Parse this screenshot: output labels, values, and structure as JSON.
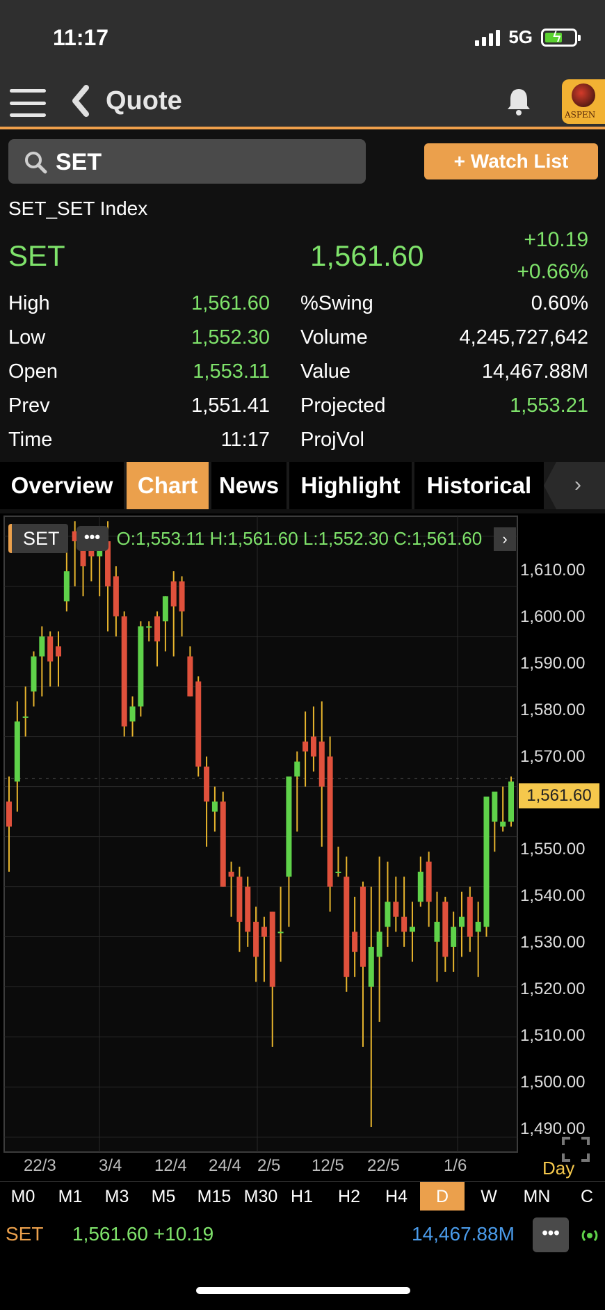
{
  "status_bar": {
    "time": "11:17",
    "network": "5G"
  },
  "header": {
    "title": "Quote"
  },
  "logo": {
    "text": "ASPEN"
  },
  "search": {
    "value": "SET"
  },
  "watch_list_label": "+ Watch List",
  "quote": {
    "index_name": "SET_SET Index",
    "symbol": "SET",
    "last": "1,561.60",
    "change": "+10.19",
    "change_pct": "+0.66%"
  },
  "stats": {
    "left": [
      {
        "label": "High",
        "value": "1,561.60",
        "color": "green"
      },
      {
        "label": "Low",
        "value": "1,552.30",
        "color": "green"
      },
      {
        "label": "Open",
        "value": "1,553.11",
        "color": "green"
      },
      {
        "label": "Prev",
        "value": "1,551.41",
        "color": "white"
      },
      {
        "label": "Time",
        "value": "11:17",
        "color": "white"
      }
    ],
    "right": [
      {
        "label": "%Swing",
        "value": "0.60%",
        "color": "white"
      },
      {
        "label": "Volume",
        "value": "4,245,727,642",
        "color": "white"
      },
      {
        "label": "Value",
        "value": "14,467.88M",
        "color": "white"
      },
      {
        "label": "Projected",
        "value": "1,553.21",
        "color": "green"
      },
      {
        "label": "ProjVol",
        "value": "",
        "color": "white"
      }
    ]
  },
  "tabs": [
    "Overview",
    "Chart",
    "News",
    "Highlight",
    "Historical"
  ],
  "active_tab": "Chart",
  "chart_header": {
    "symbol": "SET",
    "more": "•••",
    "ohlc": "O:1,553.11  H:1,561.60  L:1,552.30  C:1,561.60"
  },
  "chart_data": {
    "type": "candlestick",
    "y_ticks": [
      "1,610.00",
      "1,600.00",
      "1,590.00",
      "1,580.00",
      "1,570.00",
      "1,560.00",
      "1,550.00",
      "1,540.00",
      "1,530.00",
      "1,520.00",
      "1,510.00",
      "1,500.00",
      "1,490.00"
    ],
    "ylim": [
      1487,
      1614
    ],
    "x_ticks": [
      "22/3",
      "3/4",
      "12/4",
      "24/4",
      "2/5",
      "12/5",
      "22/5",
      "1/6"
    ],
    "last_price_flag": "1,561.60",
    "period_label": "Day",
    "colors": {
      "up": "#5fd24a",
      "down": "#e0513c",
      "wick": "#e8b52d"
    },
    "candles": [
      [
        1557,
        1562,
        1543,
        1552
      ],
      [
        1561,
        1577,
        1555,
        1573
      ],
      [
        1574,
        1580,
        1570,
        1574
      ],
      [
        1579,
        1587,
        1576,
        1586
      ],
      [
        1586,
        1592,
        1578,
        1590
      ],
      [
        1590,
        1591,
        1580,
        1585
      ],
      [
        1588,
        1591,
        1580,
        1586
      ],
      [
        1597,
        1607,
        1595,
        1603
      ],
      [
        1611,
        1613,
        1600,
        1609
      ],
      [
        1609,
        1612,
        1598,
        1604
      ],
      [
        1609,
        1612,
        1601,
        1606
      ],
      [
        1606,
        1609,
        1598,
        1609
      ],
      [
        1609,
        1613,
        1591,
        1600
      ],
      [
        1602,
        1604,
        1590,
        1594
      ],
      [
        1594,
        1595,
        1570,
        1572
      ],
      [
        1573,
        1578,
        1570,
        1576
      ],
      [
        1576,
        1593,
        1574,
        1592
      ],
      [
        1592,
        1593,
        1589,
        1592
      ],
      [
        1594,
        1595,
        1584,
        1589
      ],
      [
        1593,
        1598,
        1587,
        1598
      ],
      [
        1601,
        1603,
        1586,
        1596
      ],
      [
        1601,
        1602,
        1590,
        1595
      ],
      [
        1586,
        1588,
        1578,
        1578
      ],
      [
        1581,
        1582,
        1562,
        1564
      ],
      [
        1564,
        1566,
        1548,
        1557
      ],
      [
        1555,
        1560,
        1551,
        1557
      ],
      [
        1557,
        1559,
        1540,
        1540
      ],
      [
        1543,
        1545,
        1534,
        1542
      ],
      [
        1542,
        1544,
        1527,
        1533
      ],
      [
        1540,
        1542,
        1528,
        1531
      ],
      [
        1533,
        1536,
        1521,
        1526
      ],
      [
        1532,
        1534,
        1521,
        1530
      ],
      [
        1535,
        1535,
        1508,
        1520
      ],
      [
        1531,
        1540,
        1525,
        1531
      ],
      [
        1542,
        1550,
        1532,
        1562
      ],
      [
        1562,
        1567,
        1551,
        1565
      ],
      [
        1569,
        1575,
        1560,
        1567
      ],
      [
        1570,
        1576,
        1563,
        1566
      ],
      [
        1569,
        1577,
        1548,
        1560
      ],
      [
        1566,
        1570,
        1535,
        1540
      ],
      [
        1543,
        1548,
        1542,
        1543
      ],
      [
        1542,
        1546,
        1519,
        1522
      ],
      [
        1531,
        1538,
        1522,
        1527
      ],
      [
        1540,
        1541,
        1508,
        1524
      ],
      [
        1520,
        1540,
        1492,
        1528
      ],
      [
        1526,
        1546,
        1513,
        1531
      ],
      [
        1532,
        1545,
        1528,
        1537
      ],
      [
        1537,
        1542,
        1531,
        1534
      ],
      [
        1534,
        1542,
        1528,
        1531
      ],
      [
        1531,
        1537,
        1525,
        1532
      ],
      [
        1537,
        1546,
        1536,
        1543
      ],
      [
        1545,
        1547,
        1532,
        1537
      ],
      [
        1529,
        1539,
        1521,
        1533
      ],
      [
        1537,
        1538,
        1523,
        1526
      ],
      [
        1528,
        1535,
        1523,
        1532
      ],
      [
        1532,
        1539,
        1526,
        1534
      ],
      [
        1538,
        1540,
        1527,
        1530
      ],
      [
        1531,
        1537,
        1522,
        1533
      ],
      [
        1532,
        1556,
        1530,
        1558
      ],
      [
        1553,
        1558,
        1547,
        1559
      ],
      [
        1552,
        1560,
        1551,
        1553
      ],
      [
        1553,
        1562,
        1552,
        1561
      ]
    ]
  },
  "timeframes": [
    "M0",
    "M1",
    "M3",
    "M5",
    "M15",
    "M30",
    "H1",
    "H2",
    "H4",
    "D",
    "W",
    "MN",
    "C"
  ],
  "active_timeframe": "D",
  "ticker": {
    "symbol": "SET",
    "price_change": "1,561.60 +10.19",
    "value": "14,467.88M",
    "more": "•••"
  }
}
